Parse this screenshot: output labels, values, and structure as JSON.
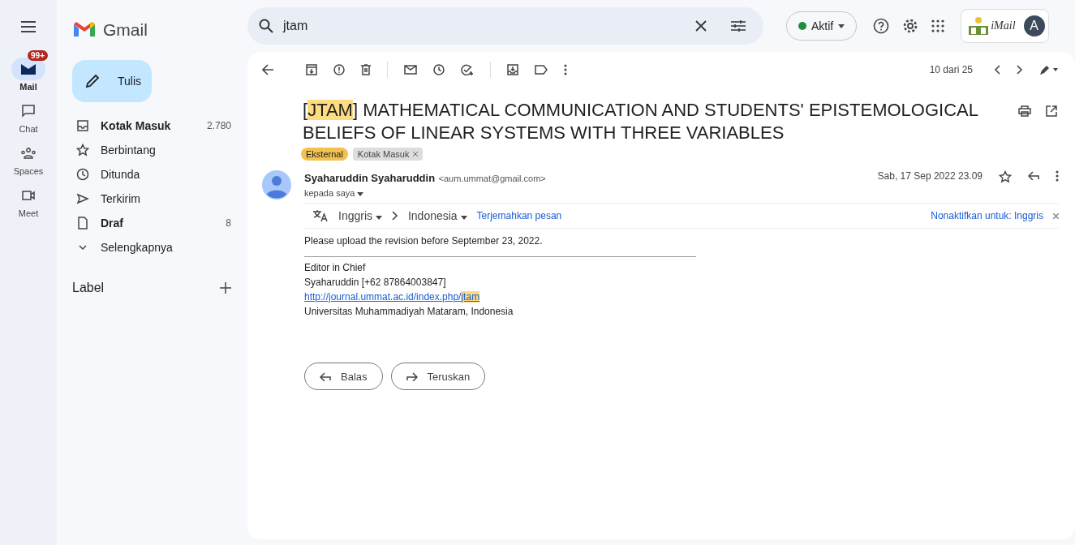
{
  "app": {
    "name": "Gmail"
  },
  "rail": [
    {
      "label": "Mail",
      "selected": true,
      "badge": "99+"
    },
    {
      "label": "Chat",
      "selected": false
    },
    {
      "label": "Spaces",
      "selected": false
    },
    {
      "label": "Meet",
      "selected": false
    }
  ],
  "compose": {
    "label": "Tulis"
  },
  "folders": [
    {
      "label": "Kotak Masuk",
      "count": "2.780",
      "bold": true
    },
    {
      "label": "Berbintang",
      "bold": false
    },
    {
      "label": "Ditunda",
      "bold": false
    },
    {
      "label": "Terkirim",
      "bold": false
    },
    {
      "label": "Draf",
      "count": "8",
      "bold": true
    },
    {
      "label": "Selengkapnya",
      "bold": false
    }
  ],
  "labels_heading": "Label",
  "search": {
    "value": "jtam"
  },
  "status": {
    "label": "Aktif",
    "color": "#1e8e3e"
  },
  "account": {
    "logo_text": "iMail",
    "avatar": "A"
  },
  "toolbar": {
    "pager": "10 dari 25"
  },
  "subject_parts": [
    {
      "text": "[",
      "highlighted": false
    },
    {
      "text": "JTAM",
      "highlighted": true
    },
    {
      "text": "] MATHEMATICAL COMMUNICATION AND STUDENTS' EPISTEMOLOGICAL BELIEFS OF LINEAR SYSTEMS WITH THREE VARIABLES",
      "highlighted": false
    }
  ],
  "tags": [
    {
      "label": "Eksternal",
      "kind": "external"
    },
    {
      "label": "Kotak Masuk",
      "kind": "label"
    }
  ],
  "message": {
    "sender": "Syaharuddin Syaharuddin",
    "email": "<aum.ummat@gmail.com>",
    "to": "kepada saya",
    "date": "Sab, 17 Sep 2022 23.09"
  },
  "translate": {
    "from": "Inggris",
    "to": "Indonesia",
    "action": "Terjemahkan pesan",
    "disable": "Nonaktifkan untuk: Inggris"
  },
  "body": {
    "text": "Please upload the revision before September 23, 2022.",
    "signature": [
      "Editor in Chief",
      "Syaharuddin [+62 87864003847]"
    ],
    "link_parts": [
      {
        "text": "http://journal.ummat.ac.id/index.php/",
        "highlighted": false
      },
      {
        "text": "jtam",
        "highlighted": true
      }
    ],
    "affiliation": "Universitas Muhammadiyah Mataram, Indonesia"
  },
  "actions": [
    {
      "label": "Balas",
      "kind": "reply"
    },
    {
      "label": "Teruskan",
      "kind": "forward"
    }
  ]
}
